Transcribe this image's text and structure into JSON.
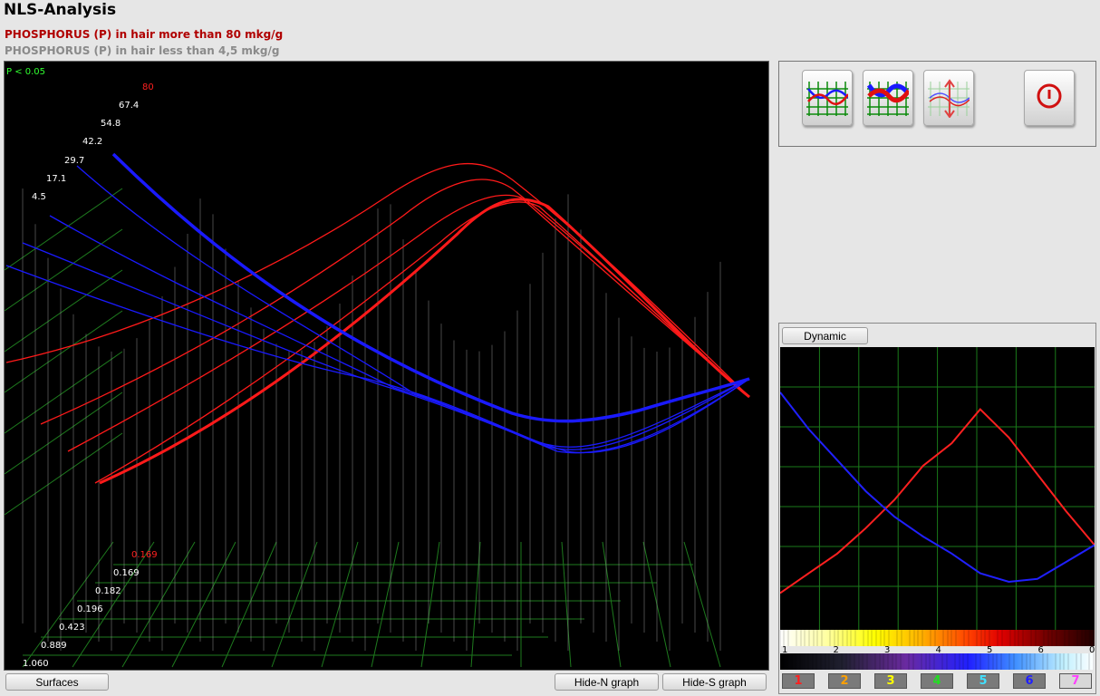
{
  "app": {
    "title": "NLS-Analysis"
  },
  "subtitles": {
    "high": "PHOSPHORUS (P) in hair more than 80 mkg/g",
    "low": "PHOSPHORUS (P) in hair less than 4,5 mkg/g"
  },
  "graph3d": {
    "p_label": "P < 0.05",
    "depth_scale": [
      "80",
      "67.4",
      "54.8",
      "42.2",
      "29.7",
      "17.1",
      "4.5"
    ],
    "front_scale": [
      "0.169",
      "0.169",
      "0.182",
      "0.196",
      "0.423",
      "0.889",
      "1.060"
    ],
    "colors": {
      "grid": "#1e7a1e",
      "verticals": "#9a9a9a",
      "series_high": "#ff1a1a",
      "series_low": "#1a1aff",
      "label_red": "#ff2020",
      "label_white": "#ffffff",
      "label_green": "#30ff30"
    }
  },
  "buttons": {
    "surfaces": "Surfaces",
    "hide_n": "Hide-N graph",
    "hide_s": "Hide-S graph",
    "dynamic": "Dynamic"
  },
  "toolbar": {
    "icons": [
      "graph-curves-icon",
      "graph-bold-curves-icon",
      "graph-spread-icon",
      "power-icon"
    ]
  },
  "dynamic_chart": {
    "series": [
      {
        "color": "#ff2020",
        "values": [
          0.13,
          0.2,
          0.27,
          0.36,
          0.46,
          0.58,
          0.66,
          0.78,
          0.68,
          0.55,
          0.42,
          0.3
        ]
      },
      {
        "color": "#2020ff",
        "values": [
          0.84,
          0.71,
          0.6,
          0.49,
          0.4,
          0.33,
          0.27,
          0.2,
          0.17,
          0.18,
          0.24,
          0.3
        ]
      }
    ]
  },
  "spectrum": {
    "labels": [
      "1",
      "2",
      "3",
      "4",
      "5",
      "6",
      "0"
    ]
  },
  "channels": [
    {
      "label": "1",
      "color": "#ff2020"
    },
    {
      "label": "2",
      "color": "#ffa000"
    },
    {
      "label": "3",
      "color": "#ffff00"
    },
    {
      "label": "4",
      "color": "#20e020"
    },
    {
      "label": "5",
      "color": "#40e0ff"
    },
    {
      "label": "6",
      "color": "#2020ff"
    },
    {
      "label": "7",
      "color": "#ff40ff"
    }
  ]
}
